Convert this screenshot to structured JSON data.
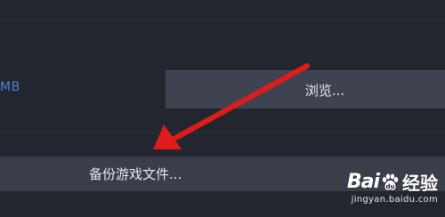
{
  "storage": {
    "size_unit_fragment": "MB"
  },
  "buttons": {
    "browse_label": "浏览...",
    "backup_label": "备份游戏文件..."
  },
  "watermark": {
    "brand_prefix": "Bai",
    "brand_suffix": "经验",
    "url": "jingyan.baidu.com"
  },
  "colors": {
    "background": "#23262e",
    "button": "#3e434f",
    "link_blue": "#4a86d6",
    "annotation_arrow": "#e01b1b"
  }
}
